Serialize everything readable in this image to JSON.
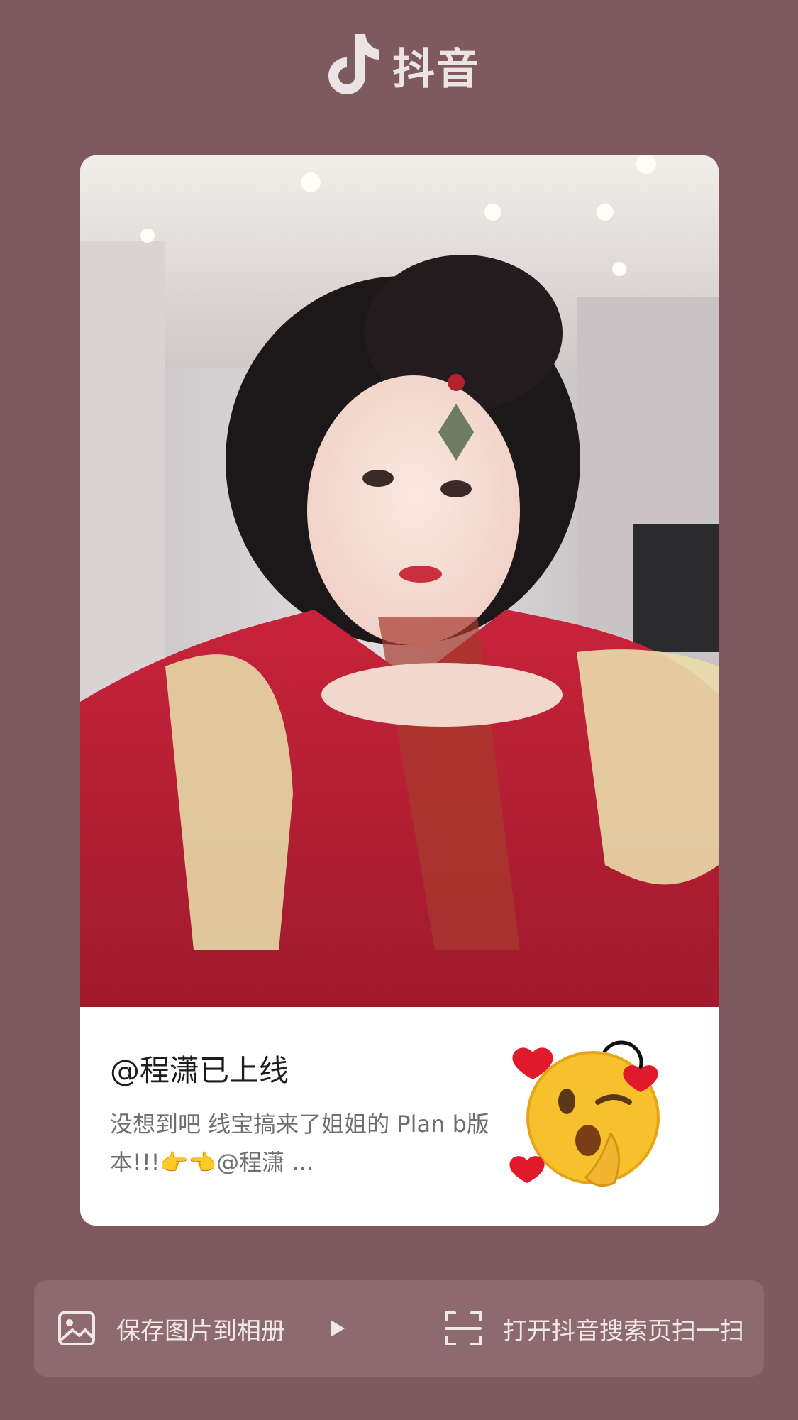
{
  "header": {
    "app_name": "抖音",
    "logo_icon": "douyin-note-icon"
  },
  "card": {
    "author": "@程潇已上线",
    "description": "没想到吧 线宝搞来了姐姐的 Plan b版本!!!👉👈@程潇 ...",
    "badge_icon": "blowing-kiss-emoji-icon"
  },
  "actions": {
    "save_label": "保存图片到相册",
    "scan_label": "打开抖音搜索页扫一扫",
    "save_icon": "image-icon",
    "scan_icon": "scan-icon",
    "play_icon": "play-triangle-icon"
  },
  "colors": {
    "background": "#7e5a5e",
    "bar": "#8d6a6d",
    "text_light": "#efe7e8"
  }
}
